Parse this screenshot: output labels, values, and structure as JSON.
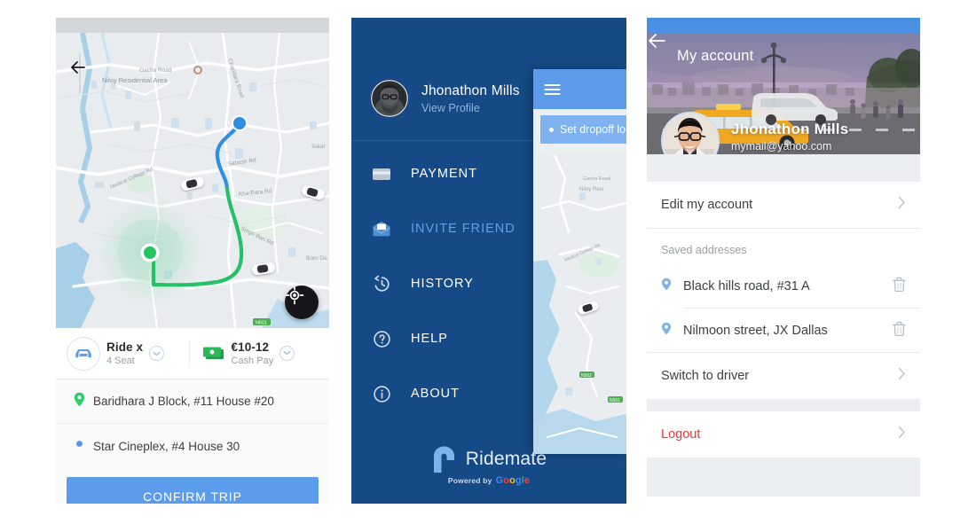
{
  "colors": {
    "accent_blue": "#5c9ced",
    "drawer_blue": "#164a86",
    "status_blue": "#4a90e2",
    "green_route": "#23c265",
    "logout_red": "#e53935",
    "muted_grey": "#9aa0a6"
  },
  "panel1": {
    "name": "ride-confirm-screen",
    "back_icon": "arrow-left-icon",
    "gps_icon": "my-location-icon",
    "map": {
      "labels": [
        "Gacha Road",
        "Niloy Residential Area",
        "Chandara Road",
        "Satatsh Rd",
        "Kha-Para Rd",
        "Medical College Rd",
        "Singh Bari Rd",
        "Boro De",
        "N501"
      ],
      "pickup_marker": "green-dot-marker",
      "dropoff_marker": "blue-dot-marker",
      "car_markers": 3
    },
    "options": [
      {
        "icon": "car-icon",
        "title": "Ride x",
        "subtitle": "4 Seat",
        "chevron": "chevron-down-icon"
      },
      {
        "icon": "cash-icon",
        "title": "€10-12",
        "subtitle": "Cash Pay",
        "chevron": "chevron-down-icon"
      }
    ],
    "addresses": [
      {
        "pin": "pickup-pin-icon",
        "text": "Baridhara J Block, #11 House #20"
      },
      {
        "pin": "dropoff-dot-icon",
        "text": "Star Cineplex, #4 House 30"
      }
    ],
    "confirm_label": "CONFIRM TRIP"
  },
  "panel2": {
    "name": "navigation-drawer-screen",
    "profile": {
      "name": "Jhonathon Mills",
      "link": "View Profile",
      "avatar": "user-avatar"
    },
    "menu": [
      {
        "icon": "credit-card-icon",
        "label": "PAYMENT",
        "active": false
      },
      {
        "icon": "envelope-icon",
        "label": "INVITE FRIEND",
        "active": true
      },
      {
        "icon": "history-clock-icon",
        "label": "HISTORY",
        "active": false
      },
      {
        "icon": "help-circle-icon",
        "label": "HELP",
        "active": false
      },
      {
        "icon": "info-circle-icon",
        "label": "ABOUT",
        "active": false
      }
    ],
    "logo": {
      "icon": "ridemate-logo-icon",
      "text": "Ridemate",
      "powered_by": "Powered by",
      "provider": "Google"
    },
    "overlay": {
      "menu_icon": "hamburger-menu-icon",
      "search_text": "Set dropoff lo",
      "map_labels": [
        "Gacha Road",
        "Niloy Resi",
        "Medical College Rd",
        "N502",
        "N501"
      ]
    }
  },
  "panel3": {
    "name": "my-account-screen",
    "header": {
      "back_icon": "arrow-left-icon",
      "title": "My account",
      "user_name": "Jhonathon Mills",
      "user_email": "mymail@yahoo.com",
      "avatar": "user-avatar"
    },
    "edit_account": {
      "label": "Edit my account",
      "chevron": "chevron-right-icon"
    },
    "saved_addresses_title": "Saved addresses",
    "saved_addresses": [
      {
        "pin": "location-pin-icon",
        "label": "Black hills road, #31 A",
        "delete": "trash-icon"
      },
      {
        "pin": "location-pin-icon",
        "label": "Nilmoon street, JX Dallas",
        "delete": "trash-icon"
      }
    ],
    "switch_driver": {
      "label": "Switch to driver",
      "chevron": "chevron-right-icon"
    },
    "logout": {
      "label": "Logout",
      "chevron": "chevron-right-icon"
    }
  }
}
